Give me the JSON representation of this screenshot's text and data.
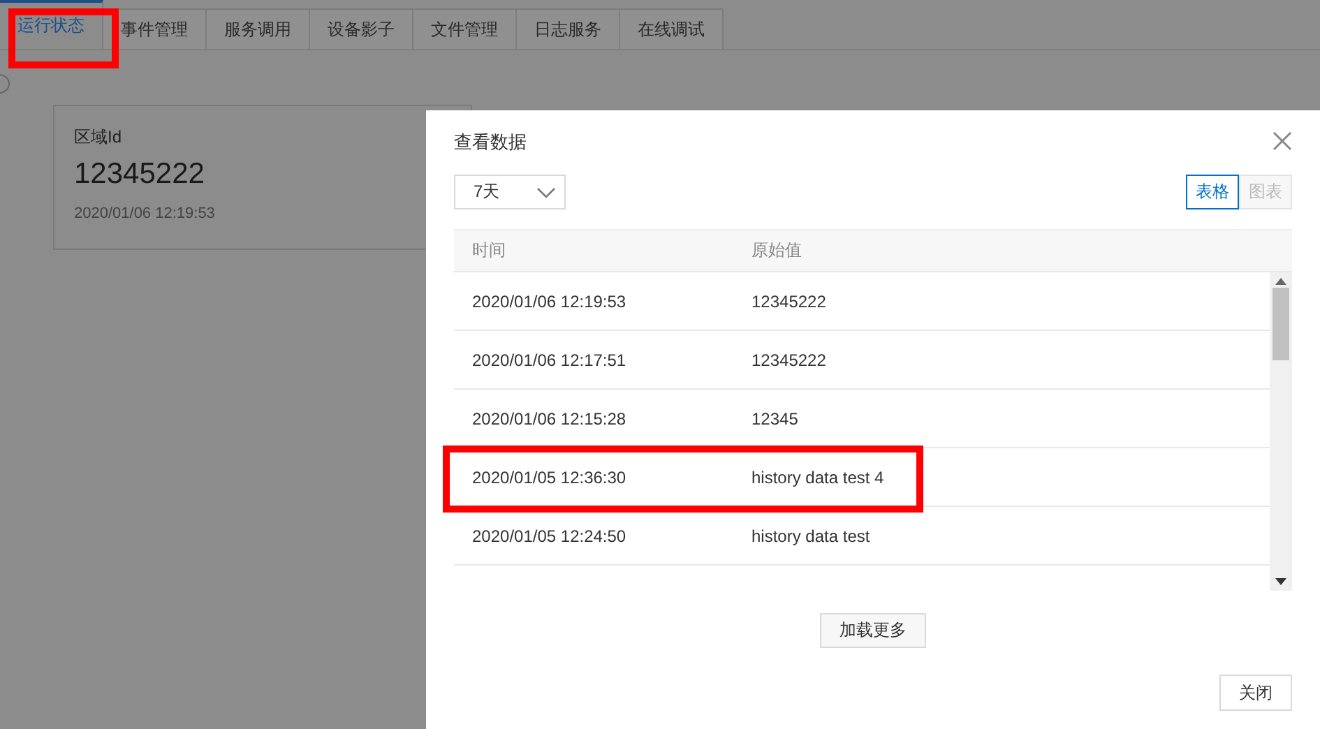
{
  "tabs": [
    {
      "label": "运行状态",
      "selected": true
    },
    {
      "label": "事件管理",
      "selected": false
    },
    {
      "label": "服务调用",
      "selected": false
    },
    {
      "label": "设备影子",
      "selected": false
    },
    {
      "label": "文件管理",
      "selected": false
    },
    {
      "label": "日志服务",
      "selected": false
    },
    {
      "label": "在线调试",
      "selected": false
    }
  ],
  "property_card": {
    "name": "区域Id",
    "value": "12345222",
    "time": "2020/01/06 12:19:53"
  },
  "dialog": {
    "title": "查看数据",
    "range": "7天",
    "views": [
      {
        "label": "表格",
        "selected": true
      },
      {
        "label": "图表",
        "selected": false
      }
    ],
    "columns": [
      "时间",
      "原始值"
    ],
    "rows": [
      {
        "time": "2020/01/06 12:19:53",
        "value": "12345222",
        "highlighted": false
      },
      {
        "time": "2020/01/06 12:17:51",
        "value": "12345222",
        "highlighted": false
      },
      {
        "time": "2020/01/06 12:15:28",
        "value": "12345",
        "highlighted": false
      },
      {
        "time": "2020/01/05 12:36:30",
        "value": "history data test 4",
        "highlighted": true
      },
      {
        "time": "2020/01/05 12:24:50",
        "value": "history data test",
        "highlighted": false
      }
    ],
    "load_more": "加载更多",
    "close": "关闭"
  }
}
